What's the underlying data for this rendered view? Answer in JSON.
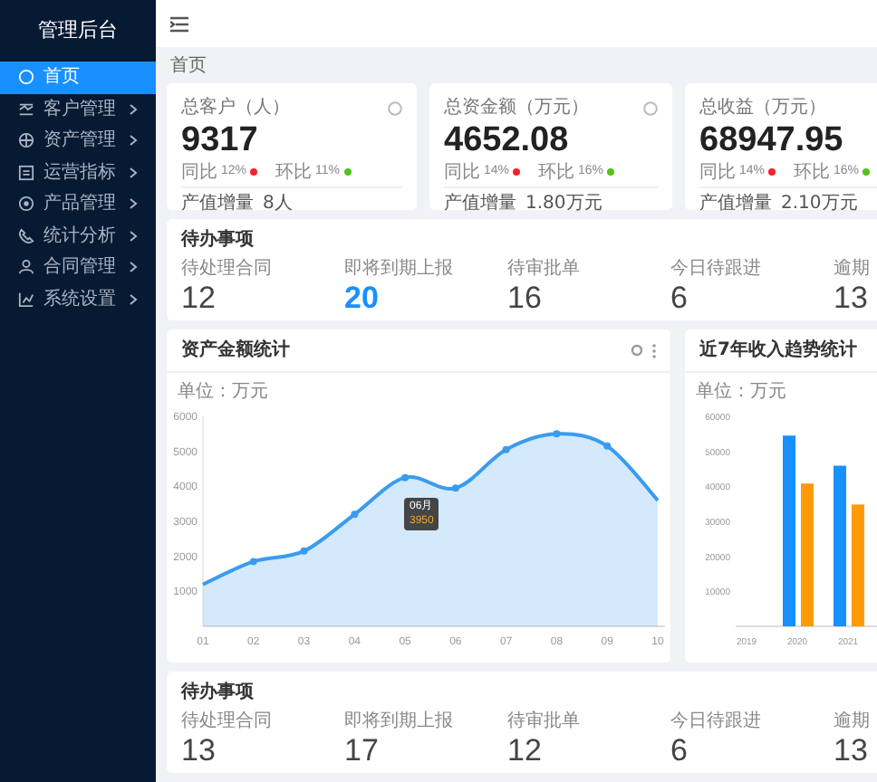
{
  "sidebar": {
    "title": "管理后台",
    "items": [
      {
        "label": "首页",
        "selected": true,
        "has_children": false
      },
      {
        "label": "客户管理",
        "selected": false,
        "has_children": true
      },
      {
        "label": "资产管理",
        "selected": false,
        "has_children": true
      },
      {
        "label": "运营指标",
        "selected": false,
        "has_children": true
      },
      {
        "label": "产品管理",
        "selected": false,
        "has_children": true
      },
      {
        "label": "统计分析",
        "selected": false,
        "has_children": true
      },
      {
        "label": "合同管理",
        "selected": false,
        "has_children": true
      },
      {
        "label": "系统设置",
        "selected": false,
        "has_children": true
      }
    ]
  },
  "breadcrumb": "首页",
  "stat_cards": [
    {
      "label": "总客户（人）",
      "value": "9317",
      "yoy_label": "同比",
      "yoy": "12%",
      "mom_label": "环比",
      "mom": "11%",
      "footer_label": "产值增量",
      "footer_value": "8人"
    },
    {
      "label": "总资金额（万元）",
      "value": "4652.08",
      "yoy_label": "同比",
      "yoy": "14%",
      "mom_label": "环比",
      "mom": "16%",
      "footer_label": "产值增量",
      "footer_value": "1.80万元"
    },
    {
      "label": "总收益（万元）",
      "value": "68947.95",
      "yoy_label": "同比",
      "yoy": "14%",
      "mom_label": "环比",
      "mom": "16%",
      "footer_label": "产值增量",
      "footer_value": "2.10万元"
    }
  ],
  "todo_top": {
    "title": "待办事项",
    "items": [
      {
        "label": "待处理合同",
        "value": "12",
        "highlight": false
      },
      {
        "label": "即将到期上报",
        "value": "20",
        "highlight": true
      },
      {
        "label": "待审批单",
        "value": "16",
        "highlight": false
      },
      {
        "label": "今日待跟进",
        "value": "6",
        "highlight": false
      },
      {
        "label": "逾期",
        "value": "13",
        "highlight": false
      }
    ]
  },
  "line_card": {
    "chart_data": {
      "type": "area",
      "title": "资产金额统计",
      "ylabel": "单位：万元",
      "categories": [
        "01",
        "02",
        "03",
        "04",
        "05",
        "06",
        "07",
        "08",
        "09",
        "10"
      ],
      "ylim": [
        0,
        6000
      ],
      "yticks": [
        1000,
        2000,
        3000,
        4000,
        5000,
        6000
      ],
      "series": [
        {
          "color": "#3a9bf0",
          "values": [
            1200,
            1850,
            2150,
            3200,
            4250,
            3950,
            5050,
            5500,
            5150,
            3600
          ]
        }
      ]
    },
    "tooltip": {
      "title": "06月",
      "value": "3950"
    }
  },
  "bar_card": {
    "chart_data": {
      "type": "bar",
      "title": "近7年收入趋势统计",
      "ylabel": "单位：万元",
      "categories": [
        "2019",
        "2020",
        "2021"
      ],
      "ylim": [
        0,
        60000
      ],
      "yticks": [
        10000,
        20000,
        30000,
        40000,
        50000,
        60000
      ],
      "series": [
        {
          "color": "#1890ff",
          "values": [
            null,
            54500,
            45900
          ]
        },
        {
          "color": "#ff9a0b",
          "values": [
            null,
            40800,
            34800
          ]
        }
      ]
    }
  },
  "todo_bottom": {
    "title": "待办事项",
    "items": [
      {
        "label": "待处理合同",
        "value": "13",
        "highlight": false
      },
      {
        "label": "即将到期上报",
        "value": "17",
        "highlight": false
      },
      {
        "label": "待审批单",
        "value": "12",
        "highlight": false
      },
      {
        "label": "今日待跟进",
        "value": "6",
        "highlight": false
      },
      {
        "label": "逾期",
        "value": "13",
        "highlight": false
      }
    ]
  }
}
